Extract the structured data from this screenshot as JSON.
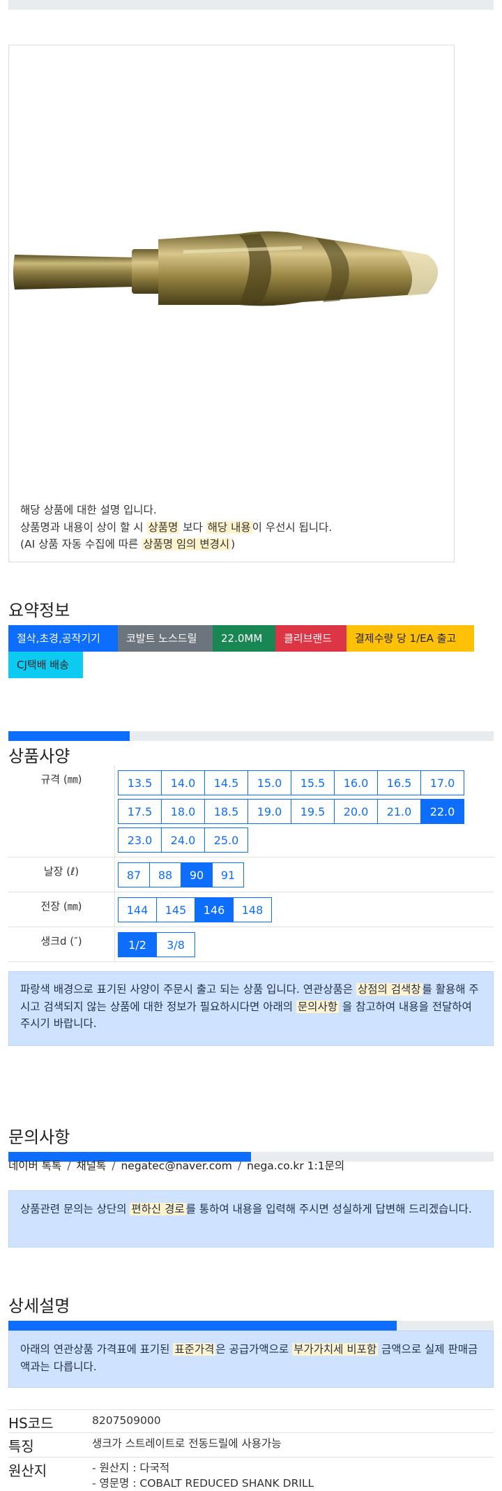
{
  "product_image": {
    "notice_lines": [
      {
        "parts": [
          {
            "t": "해당 상품에 대한 설명 입니다.",
            "hl": false
          }
        ]
      },
      {
        "parts": [
          {
            "t": "상품명과 내용이 상이 할 시 ",
            "hl": false
          },
          {
            "t": "상품명",
            "hl": true
          },
          {
            "t": " 보다 ",
            "hl": false
          },
          {
            "t": "해당 내용",
            "hl": true
          },
          {
            "t": "이 우선시 됩니다.",
            "hl": false
          }
        ]
      },
      {
        "parts": [
          {
            "t": "(AI 상품 자동 수집에 따른 ",
            "hl": false
          },
          {
            "t": "상품명 임의 변경시",
            "hl": true
          },
          {
            "t": ")",
            "hl": false
          }
        ]
      }
    ]
  },
  "summary": {
    "title": "요약정보",
    "tags": [
      {
        "label": "절삭,초경,공작기기",
        "color": "#0d6efd",
        "text": "#ffffff"
      },
      {
        "label": "코발트 노스드릴",
        "color": "#6c757d",
        "text": "#ffffff"
      },
      {
        "label": "22.0MM",
        "color": "#198754",
        "text": "#ffffff"
      },
      {
        "label": "클리브랜드",
        "color": "#dc3545",
        "text": "#ffffff"
      },
      {
        "label": "결제수량 당 1/EA 출고",
        "color": "#ffc107",
        "text": "#212529"
      },
      {
        "label": "CJ택배 배송",
        "color": "#0dcaf0",
        "text": "#212529"
      }
    ]
  },
  "spec": {
    "title": "상품사양",
    "progress": 0.25,
    "rows": [
      {
        "label": "규격 (㎜)",
        "options": [
          "13.5",
          "14.0",
          "14.5",
          "15.0",
          "15.5",
          "16.0",
          "16.5",
          "17.0",
          "17.5",
          "18.0",
          "18.5",
          "19.0",
          "19.5",
          "20.0",
          "21.0",
          "22.0",
          "23.0",
          "24.0",
          "25.0"
        ],
        "selected": "22.0"
      },
      {
        "label": "날장 (ℓ)",
        "options": [
          "87",
          "88",
          "90",
          "91"
        ],
        "selected": "90"
      },
      {
        "label": "전장 (㎜)",
        "options": [
          "144",
          "145",
          "146",
          "148"
        ],
        "selected": "146"
      },
      {
        "label": "생크d (″)",
        "options": [
          "1/2",
          "3/8"
        ],
        "selected": "1/2"
      }
    ],
    "notice_parts": [
      {
        "t": "파랑색 배경으로 표기된 사양이 주문시 출고 되는 상품 입니다. 연관상품은 ",
        "hl": false
      },
      {
        "t": "상점의 검색창",
        "hl": true
      },
      {
        "t": "를 활용해 주시고 검색되지 않는 상품에 대한 정보가 필요하시다면 아래의 ",
        "hl": false
      },
      {
        "t": "문의사항",
        "hl": true
      },
      {
        "t": " 을 참고하여 내용을 전달하여 주시기 바랍니다.",
        "hl": false
      }
    ]
  },
  "inquiry": {
    "title": "문의사항",
    "progress": 0.5,
    "channels": [
      "네이버 톡톡",
      "채널톡",
      "negatec@naver.com",
      "nega.co.kr 1:1문의"
    ],
    "notice_parts": [
      {
        "t": "상품관련 문의는 상단의 ",
        "hl": false
      },
      {
        "t": "편하신 경로",
        "hl": true
      },
      {
        "t": "를 통하여 내용을 입력해 주시면 성실하게 답변해 드리겠습니다.",
        "hl": false
      }
    ]
  },
  "detail": {
    "title": "상세설명",
    "progress": 0.8,
    "notice_parts": [
      {
        "t": "아래의 연관상품 가격표에 표기된 ",
        "hl": false
      },
      {
        "t": "표준가격",
        "hl": true
      },
      {
        "t": "은 공급가액으로 ",
        "hl": false
      },
      {
        "t": "부가가치세 비포함",
        "hl": true
      },
      {
        "t": " 금액으로 실제 판매금액과는 다릅니다.",
        "hl": false
      }
    ],
    "rows": [
      {
        "key": "HS코드",
        "values": [
          "8207509000"
        ]
      },
      {
        "key": "특징",
        "values": [
          "생크가 스트레이트로 전동드릴에 사용가능"
        ]
      },
      {
        "key": "원산지",
        "values": [
          "- 원산지 : 다국적",
          "- 영문명 : COBALT REDUCED SHANK DRILL"
        ]
      }
    ]
  }
}
